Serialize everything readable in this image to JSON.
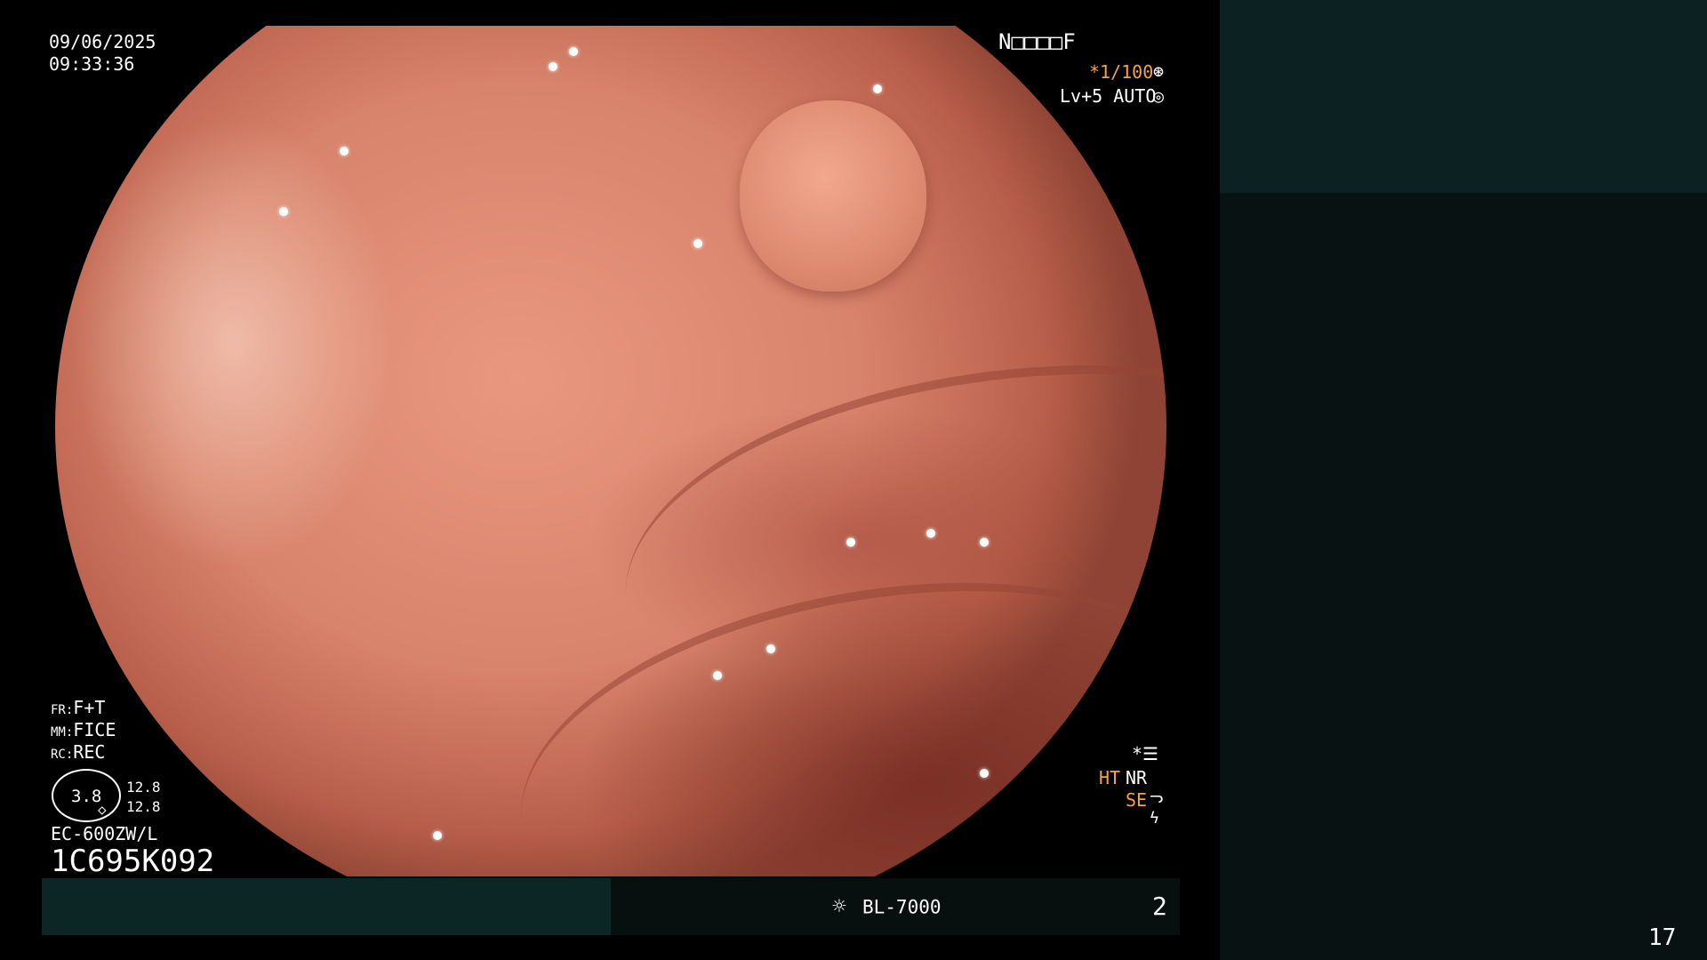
{
  "overlay": {
    "date": "09/06/2025",
    "time": "09:33:36",
    "patient_id": "N□□□□F",
    "shutter_speed": "*1/100",
    "level": "Lv+5 AUTO",
    "fr_label": "FR:",
    "fr_value": "F+T",
    "mm_label": "MM:",
    "mm_value": "FICE",
    "rc_label": "RC:",
    "rc_value": "REC",
    "zoom_value": "3.8",
    "zoom_a": "12.8",
    "zoom_b": "12.8",
    "scope_model": "EC-600ZW/L",
    "scope_serial": "1C695K092",
    "settings_marker": "*",
    "ht": "HT",
    "nr": "NR",
    "se": "SE",
    "accent_color": "#f5a340"
  },
  "status_bar": {
    "lamp_icon": "sun-icon",
    "lamp_label": "BL-7000",
    "channel": "2"
  },
  "page_number": "17",
  "icons": {
    "shutter_icon": "aperture-icon",
    "iris_icon": "iris-icon",
    "settings_icon": "settings-list-icon",
    "se_icon": "curve-icon",
    "flash_icon": "flash-icon"
  }
}
